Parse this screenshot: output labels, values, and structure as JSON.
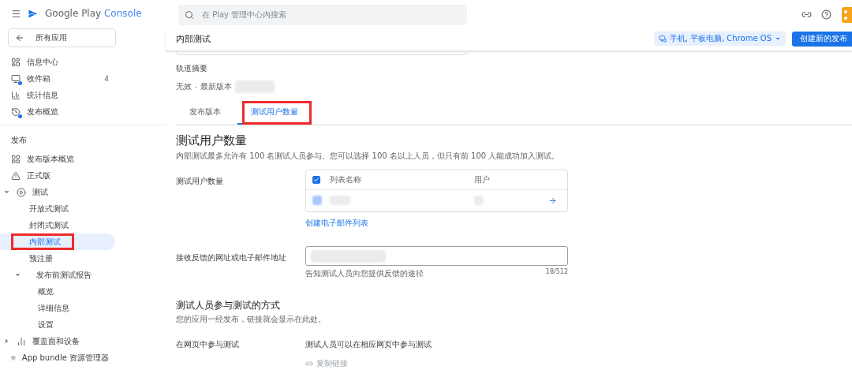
{
  "brand": {
    "product": "Google Play ",
    "product_accent": "Console"
  },
  "back_button": "所有应用",
  "nav_top": [
    {
      "label": "信息中心",
      "selected": false,
      "dot": false
    },
    {
      "label": "收件箱",
      "count": "4",
      "selected": false,
      "dot": true
    },
    {
      "label": "统计信息",
      "selected": false,
      "dot": false
    },
    {
      "label": "发布概览",
      "selected": false,
      "dot": true
    }
  ],
  "section": "发布",
  "nav_release": [
    {
      "label": "发布版本概览",
      "selected": false
    },
    {
      "label": "正式版",
      "selected": false
    },
    {
      "label": "测试",
      "selected": false,
      "expanded": true,
      "children": [
        {
          "label": "开放式测试",
          "selected": false
        },
        {
          "label": "封闭式测试",
          "selected": false
        },
        {
          "label": "内部测试",
          "selected": true,
          "highlighted": true
        },
        {
          "label": "预注册",
          "selected": false
        },
        {
          "label": "发布前测试报告",
          "selected": false,
          "expanded": true,
          "children": [
            {
              "label": "概览",
              "selected": false
            },
            {
              "label": "详细信息",
              "selected": false
            },
            {
              "label": "设置",
              "selected": false
            }
          ]
        }
      ]
    },
    {
      "label": "覆盖面和设备",
      "selected": false,
      "expanded": false
    },
    {
      "label": "App bundle 资源管理器",
      "selected": false
    }
  ],
  "search": {
    "placeholder": "在 Play 管理中心内搜索"
  },
  "page": {
    "title": "内部测试",
    "device_button": "手机, 平板电脑, Chrome OS",
    "create_button": "创建新的发布"
  },
  "track_summary": {
    "label": "轨道摘要",
    "status": "无效",
    "separator": "·",
    "latest_label": "最新版本",
    "latest_blurred": true
  },
  "tabs": [
    {
      "label": "发布版本",
      "selected": false,
      "highlighted": false
    },
    {
      "label": "测试用户数量",
      "selected": true,
      "highlighted": true
    }
  ],
  "testers": {
    "heading": "测试用户数量",
    "description": "内部测试最多允许有 100 名测试人员参与。您可以选择 100 名以上人员，但只有前 100 人能成功加入测试。",
    "field_label": "测试用户数量",
    "table": {
      "header_checked": true,
      "columns": [
        "列表名称",
        "用户"
      ],
      "rows": [
        {
          "blurred": true
        }
      ]
    },
    "link": "创建电子邮件列表"
  },
  "feedback": {
    "label": "接收反馈的网址或电子邮件地址",
    "value_blurred": true,
    "helper": "告知测试人员向您提供反馈的途径",
    "counter": "18/512"
  },
  "join": {
    "heading": "测试人员参与测试的方式",
    "description": "您的应用一经发布，链接就会显示在此处。",
    "row_label": "在网页中参与测试",
    "row_value": "测试人员可以在相应网页中参与测试",
    "copy_link": "复制链接",
    "copy_disabled": true
  }
}
